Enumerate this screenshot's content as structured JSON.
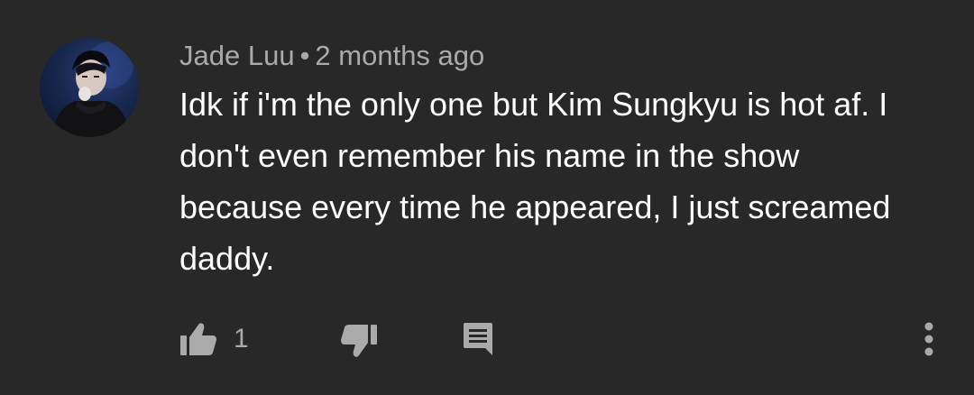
{
  "comment": {
    "author": "Jade Luu",
    "separator": "•",
    "timestamp": "2 months ago",
    "text": "Idk if i'm the only one but Kim Sungkyu is hot af. I don't even remember his name in the show because every time he appeared, I just screamed daddy.",
    "like_count": "1"
  },
  "icons": {
    "like": "thumbs-up-icon",
    "dislike": "thumbs-down-icon",
    "reply": "reply-comment-icon",
    "more": "more-vertical-icon"
  },
  "colors": {
    "background": "#282828",
    "primary_text": "#ffffff",
    "secondary_text": "#aaaaaa"
  }
}
